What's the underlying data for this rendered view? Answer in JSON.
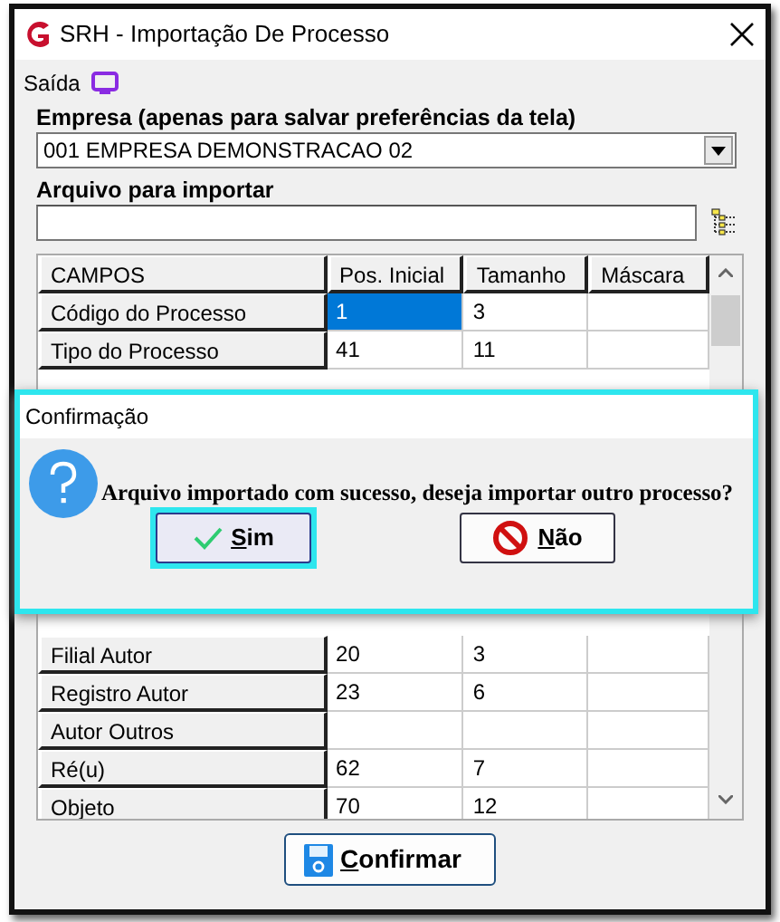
{
  "window": {
    "title": "SRH - Importação De Processo"
  },
  "menu": [
    {
      "label": "Saída"
    }
  ],
  "empresa": {
    "label": "Empresa (apenas para salvar preferências da tela)",
    "value": "001 EMPRESA DEMONSTRACAO 02"
  },
  "arquivo": {
    "label": "Arquivo para importar"
  },
  "table": {
    "columns": [
      "CAMPOS",
      "Pos. Inicial",
      "Tamanho",
      "Máscara"
    ],
    "rows_top": [
      {
        "cells": [
          {
            "text": "Código do Processo",
            "selected": false
          },
          {
            "text": "1",
            "selected": true
          },
          {
            "text": "3",
            "selected": false
          },
          {
            "selected": false
          }
        ]
      },
      {
        "cells": [
          {
            "text": "Tipo do Processo",
            "selected": false
          },
          {
            "text": "41",
            "selected": false
          },
          {
            "text": "11",
            "selected": false
          },
          {
            "selected": false
          }
        ]
      }
    ],
    "rows_bottom": [
      {
        "cells": [
          {
            "text": "Filial Autor",
            "selected": false
          },
          {
            "text": "20",
            "selected": false
          },
          {
            "text": "3",
            "selected": false
          },
          {
            "selected": false
          }
        ]
      },
      {
        "cells": [
          {
            "text": "Registro Autor",
            "selected": false
          },
          {
            "text": "23",
            "selected": false
          },
          {
            "text": "6",
            "selected": false
          },
          {
            "selected": false
          }
        ]
      },
      {
        "cells": [
          {
            "text": "Autor Outros",
            "selected": false
          },
          {
            "selected": false
          },
          {
            "selected": false
          },
          {
            "selected": false
          }
        ]
      },
      {
        "cells": [
          {
            "text": "Ré(u)",
            "selected": false
          },
          {
            "text": "62",
            "selected": false
          },
          {
            "text": "7",
            "selected": false
          },
          {
            "selected": false
          }
        ]
      },
      {
        "cells": [
          {
            "text": "Objeto",
            "selected": false
          },
          {
            "text": "70",
            "selected": false
          },
          {
            "text": "12",
            "selected": false
          },
          {
            "selected": false
          }
        ]
      }
    ]
  },
  "confirm_button": {
    "label": "Confirmar"
  },
  "dialog": {
    "title": "Confirmação",
    "message": "Arquivo importado com sucesso, deseja importar outro processo?",
    "buttons": [
      {
        "label": "Sim",
        "kind": "yes",
        "focused": true
      },
      {
        "label": "Não",
        "kind": "no",
        "focused": false
      }
    ]
  }
}
